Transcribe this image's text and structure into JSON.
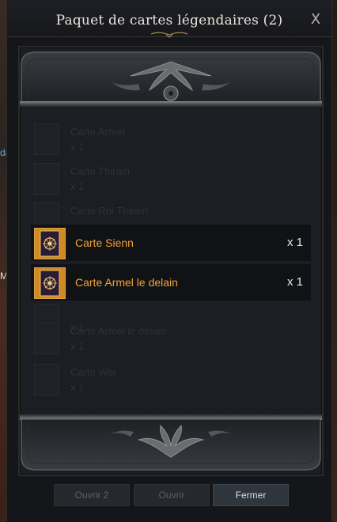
{
  "window": {
    "title": "Paquet de cartes légendaires (2)",
    "close_label": "X"
  },
  "background": {
    "edge_texts": [
      "da",
      "M"
    ]
  },
  "ghost_items": [
    {
      "name": "Carte Armel",
      "qty": "x 1"
    },
    {
      "name": "Carte Thirain",
      "qty": "x 1"
    },
    {
      "name": "Carte Roi Thirain",
      "qty": ""
    },
    {
      "name": "",
      "qty": "x 1"
    },
    {
      "name": "Carte Armel le delain",
      "qty": "x 1"
    },
    {
      "name": "Carte Wei",
      "qty": "x 1"
    }
  ],
  "items": [
    {
      "name": "Carte Sienn",
      "qty": "x 1"
    },
    {
      "name": "Carte Armel le delain",
      "qty": "x 1"
    }
  ],
  "buttons": {
    "open2": "Ouvrir 2",
    "open": "Ouvrir",
    "close": "Fermer"
  },
  "colors": {
    "item_name": "#eea33a",
    "card_thumb": "#d08a24",
    "window_bg": "#15161a"
  }
}
